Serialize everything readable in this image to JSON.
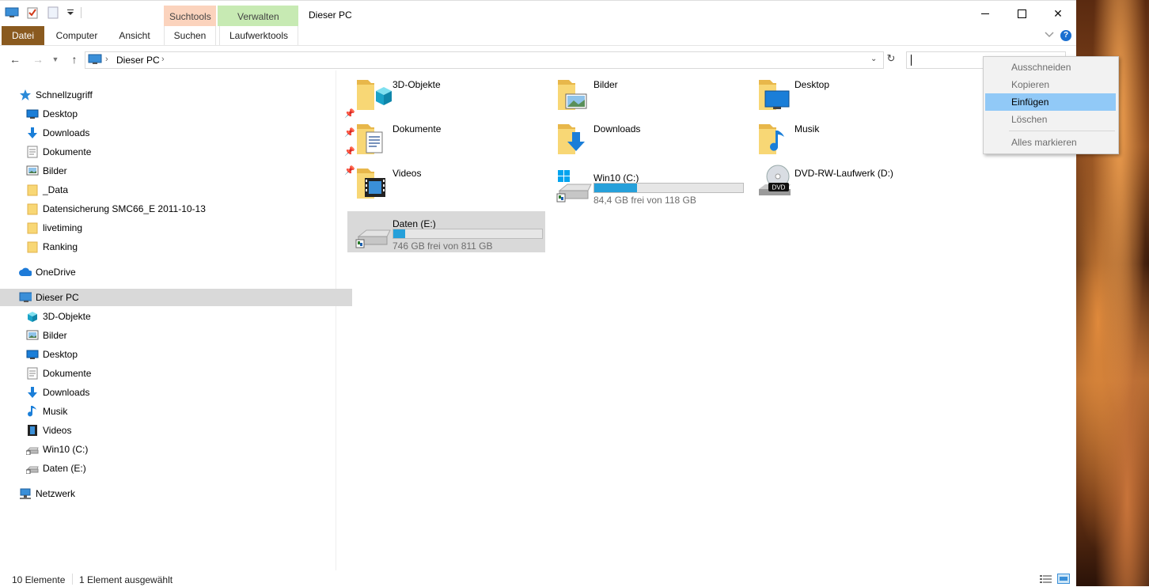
{
  "window": {
    "title": "Dieser PC",
    "contextual_tabs": {
      "search_tools": "Suchtools",
      "manage": "Verwalten"
    }
  },
  "ribbon": {
    "tabs": [
      "Datei",
      "Computer",
      "Ansicht",
      "Suchen",
      "Laufwerktools"
    ]
  },
  "address": {
    "path": [
      "Dieser PC"
    ],
    "search_value": ""
  },
  "navigation": {
    "quick_access": {
      "label": "Schnellzugriff",
      "items": [
        {
          "label": "Desktop",
          "icon": "desktop-icon",
          "pinned": true
        },
        {
          "label": "Downloads",
          "icon": "download-icon",
          "pinned": true
        },
        {
          "label": "Dokumente",
          "icon": "document-icon",
          "pinned": true
        },
        {
          "label": "Bilder",
          "icon": "pictures-icon",
          "pinned": true
        },
        {
          "label": "_Data",
          "icon": "folder-icon",
          "pinned": false
        },
        {
          "label": "Datensicherung SMC66_E 2011-10-13",
          "icon": "folder-icon",
          "pinned": false
        },
        {
          "label": "livetiming",
          "icon": "folder-icon",
          "pinned": false
        },
        {
          "label": "Ranking",
          "icon": "folder-icon",
          "pinned": false
        }
      ]
    },
    "onedrive": "OneDrive",
    "this_pc": {
      "label": "Dieser PC",
      "items": [
        {
          "label": "3D-Objekte",
          "icon": "3d-objects-icon"
        },
        {
          "label": "Bilder",
          "icon": "pictures-icon"
        },
        {
          "label": "Desktop",
          "icon": "desktop-icon"
        },
        {
          "label": "Dokumente",
          "icon": "document-icon"
        },
        {
          "label": "Downloads",
          "icon": "download-icon"
        },
        {
          "label": "Musik",
          "icon": "music-icon"
        },
        {
          "label": "Videos",
          "icon": "video-icon"
        },
        {
          "label": "Win10 (C:)",
          "icon": "drive-icon"
        },
        {
          "label": "Daten (E:)",
          "icon": "drive-icon"
        }
      ]
    },
    "network": "Netzwerk"
  },
  "content": {
    "folders": [
      {
        "label": "3D-Objekte",
        "overlay": "3d-cube"
      },
      {
        "label": "Bilder",
        "overlay": "picture"
      },
      {
        "label": "Desktop",
        "overlay": "monitor"
      },
      {
        "label": "Dokumente",
        "overlay": "document"
      },
      {
        "label": "Downloads",
        "overlay": "arrow-down"
      },
      {
        "label": "Musik",
        "overlay": "note"
      },
      {
        "label": "Videos",
        "overlay": "film"
      }
    ],
    "drives": [
      {
        "label": "Win10 (C:)",
        "free_text": "84,4 GB frei von 118 GB",
        "used_fraction": 0.285
      },
      {
        "label": "DVD-RW-Laufwerk (D:)",
        "badge": "DVD"
      },
      {
        "label": "Daten (E:)",
        "free_text": "746 GB frei von 811 GB",
        "used_fraction": 0.08,
        "selected": true
      }
    ]
  },
  "status": {
    "count": "10 Elemente",
    "selection": "1 Element ausgewählt"
  },
  "context_menu": {
    "items": [
      {
        "label": "Ausschneiden",
        "enabled": false
      },
      {
        "label": "Kopieren",
        "enabled": false
      },
      {
        "label": "Einfügen",
        "enabled": true,
        "highlighted": true
      },
      {
        "label": "Löschen",
        "enabled": false
      },
      {
        "label": "Alles markieren",
        "enabled": false
      }
    ]
  },
  "colors": {
    "file_tab": "#8a5a1f",
    "search_tools_tab": "#fbd3bd",
    "manage_tab": "#c7eab3",
    "drive_fill": "#26a0da",
    "selection": "#d9d9d9",
    "menu_highlight": "#91c9f7"
  }
}
